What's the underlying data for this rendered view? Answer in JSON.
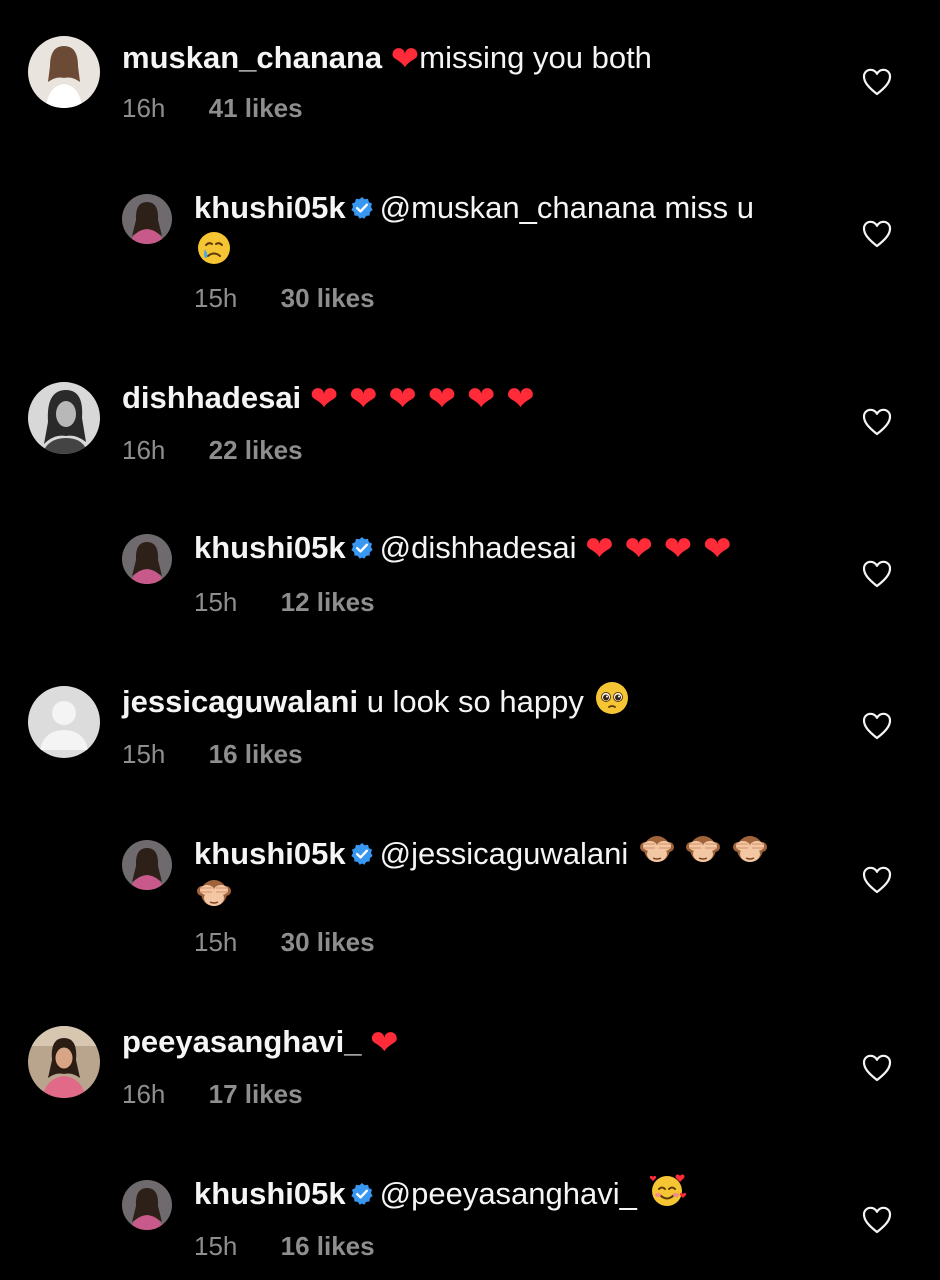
{
  "comments": [
    {
      "username": "muskan_chanana",
      "text": "missing you both",
      "time": "16h",
      "likes": "41 likes",
      "replies": [
        {
          "username": "khushi05k",
          "text": "@muskan_chanana miss u",
          "time": "15h",
          "likes": "30 likes"
        }
      ]
    },
    {
      "username": "dishhadesai",
      "text": "",
      "time": "16h",
      "likes": "22 likes",
      "replies": [
        {
          "username": "khushi05k",
          "text": "@dishhadesai",
          "time": "15h",
          "likes": "12 likes"
        }
      ]
    },
    {
      "username": "jessicaguwalani",
      "text": "u look so happy",
      "time": "15h",
      "likes": "16 likes",
      "replies": [
        {
          "username": "khushi05k",
          "text": "@jessicaguwalani",
          "time": "15h",
          "likes": "30 likes"
        }
      ]
    },
    {
      "username": "peeyasanghavi_",
      "text": "",
      "time": "16h",
      "likes": "17 likes",
      "replies": [
        {
          "username": "khushi05k",
          "text": "@peeyasanghavi_",
          "time": "15h",
          "likes": "16 likes"
        }
      ]
    }
  ],
  "icons": {
    "like": "heart-outline-icon",
    "verified": "verified-badge-icon",
    "heart_emoji": "red-heart-emoji",
    "crying_emoji": "crying-face-emoji",
    "pleading_emoji": "pleading-face-emoji",
    "see_no_evil_emoji": "see-no-evil-monkey-emoji",
    "smiling_hearts_emoji": "smiling-face-with-hearts-emoji"
  },
  "colors": {
    "background": "#000000",
    "text": "#f5f5f5",
    "meta": "#8e8e8e",
    "verified": "#3897f0",
    "heart_emoji": "#ff2b39"
  }
}
